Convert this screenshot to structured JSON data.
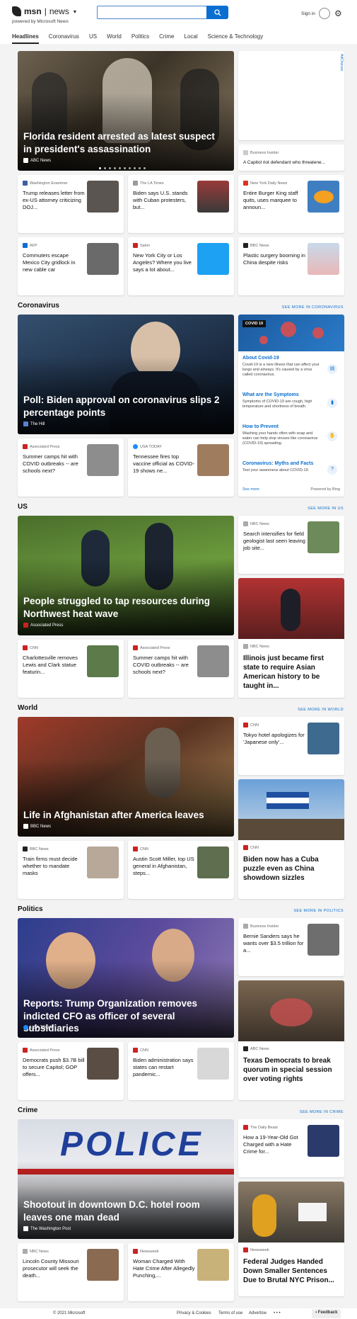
{
  "header": {
    "brand": "msn",
    "section": "news",
    "powered": "powered by Microsoft News",
    "sign_in": "Sign in"
  },
  "nav": [
    "Headlines",
    "Coronavirus",
    "US",
    "World",
    "Politics",
    "Crime",
    "Local",
    "Science & Technology"
  ],
  "headlines": {
    "hero": {
      "title": "Florida resident arrested as latest suspect in president's assassination",
      "source": "ABC News"
    },
    "ad_label": "AdChoices",
    "side": {
      "source": "Business Insider",
      "title": "A Capitol riot defendant who threatene..."
    },
    "cards": [
      {
        "source": "Washington Examiner",
        "title": "Trump releases letter from ex-US attorney criticizing DOJ..."
      },
      {
        "source": "The LA Times",
        "title": "Biden says U.S. stands with Cuban protesters, but..."
      },
      {
        "source": "New York Daily News",
        "title": "Entire Burger King staff quits, uses marquee to announ..."
      },
      {
        "source": "AFP",
        "title": "Commuters escape Mexico City gridlock in new cable car"
      },
      {
        "source": "Salon",
        "title": "New York City or Los Angeles? Where you live says a lot about..."
      },
      {
        "source": "BBC News",
        "title": "Plastic surgery booming in China despite risks"
      }
    ]
  },
  "coronavirus": {
    "heading": "Coronavirus",
    "see_more": "SEE MORE IN CORONAVIRUS",
    "hero": {
      "title": "Poll: Biden approval on coronavirus slips 2 percentage points",
      "source": "The Hill"
    },
    "cards": [
      {
        "source": "Associated Press",
        "title": "Summer camps hit with COVID outbreaks -- are schools next?"
      },
      {
        "source": "USA TODAY",
        "title": "Tennessee fires top vaccine official as COVID-19 shows ne..."
      }
    ],
    "panel": {
      "badge": "COVID 19",
      "items": [
        {
          "title": "About Covid-19",
          "desc": "Covid-19 is a new illness that can affect your lungs and airways. It's caused by a virus called coronavirus."
        },
        {
          "title": "What are the Symptoms",
          "desc": "Symptoms of COVID-19 are cough, high temperature and shortness of breath."
        },
        {
          "title": "How to Prevent",
          "desc": "Washing your hands often with soap and water can help stop viruses like coronavirus (COVID-19) spreading."
        },
        {
          "title": "Coronavirus: Myths and Facts",
          "desc": "Test your awareness about COVID-19."
        }
      ],
      "see_more": "See more",
      "powered": "Powered by Bing"
    }
  },
  "us": {
    "heading": "US",
    "see_more": "SEE MORE IN US",
    "hero": {
      "title": "People struggled to tap resources during Northwest heat wave",
      "source": "Associated Press"
    },
    "side": {
      "source": "NBC News",
      "title": "Search intensifies for field geologist last seen leaving job site..."
    },
    "big": {
      "source": "NBC News",
      "title": "Illinois just became first state to require Asian American history to be taught in..."
    },
    "cards": [
      {
        "source": "CNN",
        "title": "Charlottesville removes Lewis and Clark statue featurin..."
      },
      {
        "source": "Associated Press",
        "title": "Summer camps hit with COVID outbreaks -- are schools next?"
      }
    ]
  },
  "world": {
    "heading": "World",
    "see_more": "SEE MORE IN WORLD",
    "hero": {
      "title": "Life in Afghanistan after America leaves",
      "source": "BBC News"
    },
    "side": {
      "source": "CNN",
      "title": "Tokyo hotel apologizes for 'Japanese only'..."
    },
    "big": {
      "source": "CNN",
      "title": "Biden now has a Cuba puzzle even as China showdown sizzles"
    },
    "cards": [
      {
        "source": "BBC News",
        "title": "Train firms must decide whether to mandate masks"
      },
      {
        "source": "CNN",
        "title": "Austin Scott Miller, top US general in Afghanistan, steps..."
      }
    ]
  },
  "politics": {
    "heading": "Politics",
    "see_more": "SEE MORE IN POLITICS",
    "hero": {
      "title": "Reports: Trump Organization removes indicted CFO as officer of several subsidiaries",
      "source": "USA TODAY"
    },
    "side": {
      "source": "Business Insider",
      "title": "Bernie Sanders says he wants over $3.5 trillion for a..."
    },
    "big": {
      "source": "ABC News",
      "title": "Texas Democrats to break quorum in special session over voting rights"
    },
    "cards": [
      {
        "source": "Associated Press",
        "title": "Democrats push $3.7B bill to secure Capitol; GOP offers..."
      },
      {
        "source": "CNN",
        "title": "Biden administration says states can restart pandemic..."
      }
    ]
  },
  "crime": {
    "heading": "Crime",
    "see_more": "SEE MORE IN CRIME",
    "hero": {
      "title": "Shootout in downtown D.C. hotel room leaves one man dead",
      "source": "The Washington Post",
      "vehicle_text": "POLICE"
    },
    "side": {
      "source": "The Daily Beast",
      "title": "How a 19-Year-Old Got Charged with a Hate Crime for..."
    },
    "big": {
      "source": "Newsweek",
      "title": "Federal Judges Handed Down Smaller Sentences Due to Brutal NYC Prison..."
    },
    "cards": [
      {
        "source": "NBC News",
        "title": "Lincoln County Missouri prosecutor will seek the death..."
      },
      {
        "source": "Newsweek",
        "title": "Woman Charged With Hate Crime After Allegedly Punching,..."
      }
    ]
  },
  "footer": {
    "copyright": "© 2021 Microsoft",
    "links": [
      "Privacy & Cookies",
      "Terms of use",
      "Advertise"
    ],
    "more": "• • •",
    "feedback": "Feedback"
  }
}
